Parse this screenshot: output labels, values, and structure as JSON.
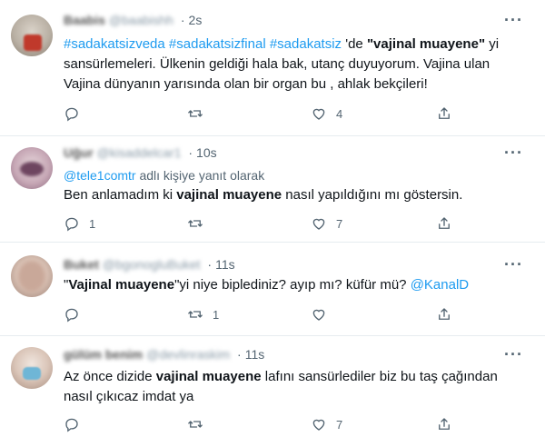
{
  "tweets": [
    {
      "name": "Baabis",
      "handle": "@baabishh",
      "time": "2s",
      "body_parts": {
        "h1": "#sadakatsizveda",
        "h2": "#sadakatsizfinal",
        "h3": "#sadakatsiz",
        "t1": " 'de ",
        "bold": "\"vajinal muayene\"",
        "t2": " yi sansürlemeleri. Ülkenin geldiği hala bak, utanç duyuyorum. Vajina ulan Vajina dünyanın yarısında olan bir organ bu , ahlak bekçileri!"
      },
      "reply_count": "",
      "retweet_count": "",
      "like_count": "4"
    },
    {
      "name": "Uğur",
      "handle": "@kisaddelcar1",
      "time": "10s",
      "reply_to_handle": "@tele1comtr",
      "reply_to_text": " adlı kişiye yanıt olarak",
      "t1": "Ben anlamadım ki ",
      "bold": "vajinal muayene",
      "t2": " nasıl yapıldığını mı göstersin.",
      "reply_count": "1",
      "retweet_count": "",
      "like_count": "7"
    },
    {
      "name": "Buket",
      "handle": "@bgonogluBuket",
      "time": "11s",
      "q": "\"",
      "bold": "Vajinal muayene",
      "t1": "\"yi niye biplediniz? ayıp mı? küfür mü? ",
      "mention": "@KanalD",
      "reply_count": "",
      "retweet_count": "1",
      "like_count": ""
    },
    {
      "name": "gülüm benim",
      "handle": "@devlinraskim",
      "time": "11s",
      "t1": "Az önce dizide ",
      "bold": "vajinal muayene",
      "t2": " lafını sansürlediler biz bu taş çağından nasıl çıkıcaz imdat ya",
      "reply_count": "",
      "retweet_count": "",
      "like_count": "7"
    }
  ],
  "ui": {
    "more_glyph": "···",
    "dot": "·",
    "icons": [
      "reply-icon",
      "retweet-icon",
      "like-icon",
      "share-icon"
    ],
    "colors": {
      "link": "#1d9bf0",
      "muted": "#536471",
      "text": "#0f1419"
    }
  }
}
